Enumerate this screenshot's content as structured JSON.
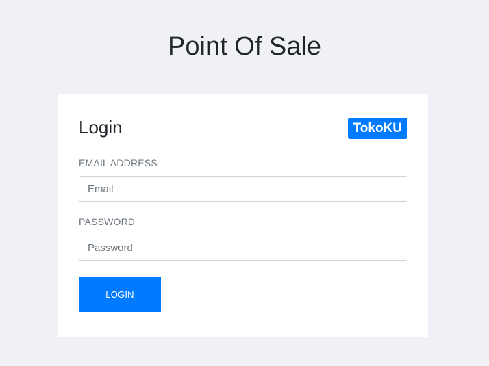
{
  "app": {
    "title": "Point Of Sale"
  },
  "login_card": {
    "title": "Login",
    "brand": "TokoKU",
    "email": {
      "label": "EMAIL ADDRESS",
      "placeholder": "Email",
      "value": ""
    },
    "password": {
      "label": "PASSWORD",
      "placeholder": "Password",
      "value": ""
    },
    "submit_label": "LOGIN"
  },
  "colors": {
    "page_background": "#f0f1f6",
    "card_background": "#ffffff",
    "accent": "#007bff",
    "label_text": "#6c757d",
    "heading_text": "#212529"
  }
}
